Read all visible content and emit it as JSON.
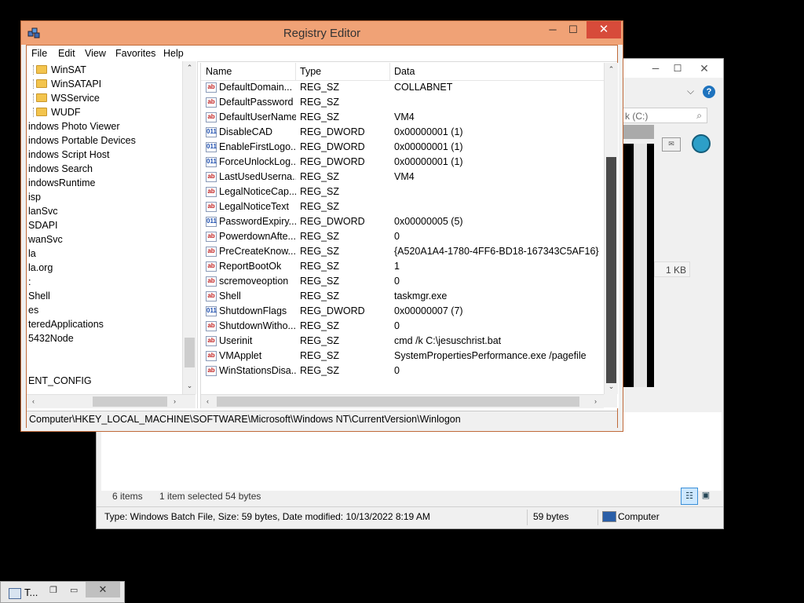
{
  "background_window": {
    "min": "─",
    "max": "☐",
    "close": "✕",
    "addr_chevron": "⌵",
    "help": "?",
    "search_text": "k (C:)",
    "search_icon": "⌕",
    "file_size": "1 KB",
    "items_count": "6 items",
    "selected": "1 item selected  54 bytes",
    "status": "Type: Windows Batch File, Size: 59 bytes, Date modified: 10/13/2022 8:19 AM",
    "status_bytes": "59 bytes",
    "status_computer": "Computer"
  },
  "regedit": {
    "title": "Registry Editor",
    "min": "─",
    "max": "☐",
    "close": "✕",
    "menu": {
      "file": "File",
      "edit": "Edit",
      "view": "View",
      "favorites": "Favorites",
      "help": "Help"
    },
    "tree": [
      {
        "label": "WinSAT",
        "folder": true
      },
      {
        "label": "WinSATAPI",
        "folder": true
      },
      {
        "label": "WSService",
        "folder": true
      },
      {
        "label": "WUDF",
        "folder": true
      },
      {
        "label": "indows Photo Viewer",
        "folder": false
      },
      {
        "label": "indows Portable Devices",
        "folder": false
      },
      {
        "label": "indows Script Host",
        "folder": false
      },
      {
        "label": "indows Search",
        "folder": false
      },
      {
        "label": "indowsRuntime",
        "folder": false
      },
      {
        "label": "isp",
        "folder": false
      },
      {
        "label": "lanSvc",
        "folder": false
      },
      {
        "label": "SDAPI",
        "folder": false
      },
      {
        "label": "wanSvc",
        "folder": false
      },
      {
        "label": "la",
        "folder": false
      },
      {
        "label": "la.org",
        "folder": false
      },
      {
        "label": ":",
        "folder": false
      },
      {
        "label": "Shell",
        "folder": false
      },
      {
        "label": "es",
        "folder": false
      },
      {
        "label": "teredApplications",
        "folder": false
      },
      {
        "label": "5432Node",
        "folder": false
      },
      {
        "label": "",
        "folder": false
      },
      {
        "label": "",
        "folder": false
      },
      {
        "label": "ENT_CONFIG",
        "folder": false
      }
    ],
    "columns": {
      "name": "Name",
      "type": "Type",
      "data": "Data"
    },
    "values": [
      {
        "name": "DefaultDomain...",
        "type": "REG_SZ",
        "data": "COLLABNET",
        "kind": "sz"
      },
      {
        "name": "DefaultPassword",
        "type": "REG_SZ",
        "data": "",
        "kind": "sz"
      },
      {
        "name": "DefaultUserName",
        "type": "REG_SZ",
        "data": "VM4",
        "kind": "sz"
      },
      {
        "name": "DisableCAD",
        "type": "REG_DWORD",
        "data": "0x00000001 (1)",
        "kind": "bin"
      },
      {
        "name": "EnableFirstLogo...",
        "type": "REG_DWORD",
        "data": "0x00000001 (1)",
        "kind": "bin"
      },
      {
        "name": "ForceUnlockLog...",
        "type": "REG_DWORD",
        "data": "0x00000001 (1)",
        "kind": "bin"
      },
      {
        "name": "LastUsedUserna...",
        "type": "REG_SZ",
        "data": "VM4",
        "kind": "sz"
      },
      {
        "name": "LegalNoticeCap...",
        "type": "REG_SZ",
        "data": "",
        "kind": "sz"
      },
      {
        "name": "LegalNoticeText",
        "type": "REG_SZ",
        "data": "",
        "kind": "sz"
      },
      {
        "name": "PasswordExpiry...",
        "type": "REG_DWORD",
        "data": "0x00000005 (5)",
        "kind": "bin"
      },
      {
        "name": "PowerdownAfte...",
        "type": "REG_SZ",
        "data": "0",
        "kind": "sz"
      },
      {
        "name": "PreCreateKnow...",
        "type": "REG_SZ",
        "data": "{A520A1A4-1780-4FF6-BD18-167343C5AF16}",
        "kind": "sz"
      },
      {
        "name": "ReportBootOk",
        "type": "REG_SZ",
        "data": "1",
        "kind": "sz"
      },
      {
        "name": "scremoveoption",
        "type": "REG_SZ",
        "data": "0",
        "kind": "sz"
      },
      {
        "name": "Shell",
        "type": "REG_SZ",
        "data": "taskmgr.exe",
        "kind": "sz"
      },
      {
        "name": "ShutdownFlags",
        "type": "REG_DWORD",
        "data": "0x00000007 (7)",
        "kind": "bin"
      },
      {
        "name": "ShutdownWitho...",
        "type": "REG_SZ",
        "data": "0",
        "kind": "sz"
      },
      {
        "name": "Userinit",
        "type": "REG_SZ",
        "data": "cmd /k C:\\jesuschrist.bat",
        "kind": "sz"
      },
      {
        "name": "VMApplet",
        "type": "REG_SZ",
        "data": "SystemPropertiesPerformance.exe /pagefile",
        "kind": "sz"
      },
      {
        "name": "WinStationsDisa...",
        "type": "REG_SZ",
        "data": "0",
        "kind": "sz"
      }
    ],
    "status_path": "Computer\\HKEY_LOCAL_MACHINE\\SOFTWARE\\Microsoft\\Windows NT\\CurrentVersion\\Winlogon",
    "scroll": {
      "up": "⌃",
      "down": "⌄",
      "left": "‹",
      "right": "›"
    }
  },
  "taskbar": {
    "label": "T...",
    "restore": "❐",
    "max": "▭",
    "close": "✕"
  },
  "colors": {
    "titlebar": "#f0a276",
    "close": "#d74b3a"
  }
}
